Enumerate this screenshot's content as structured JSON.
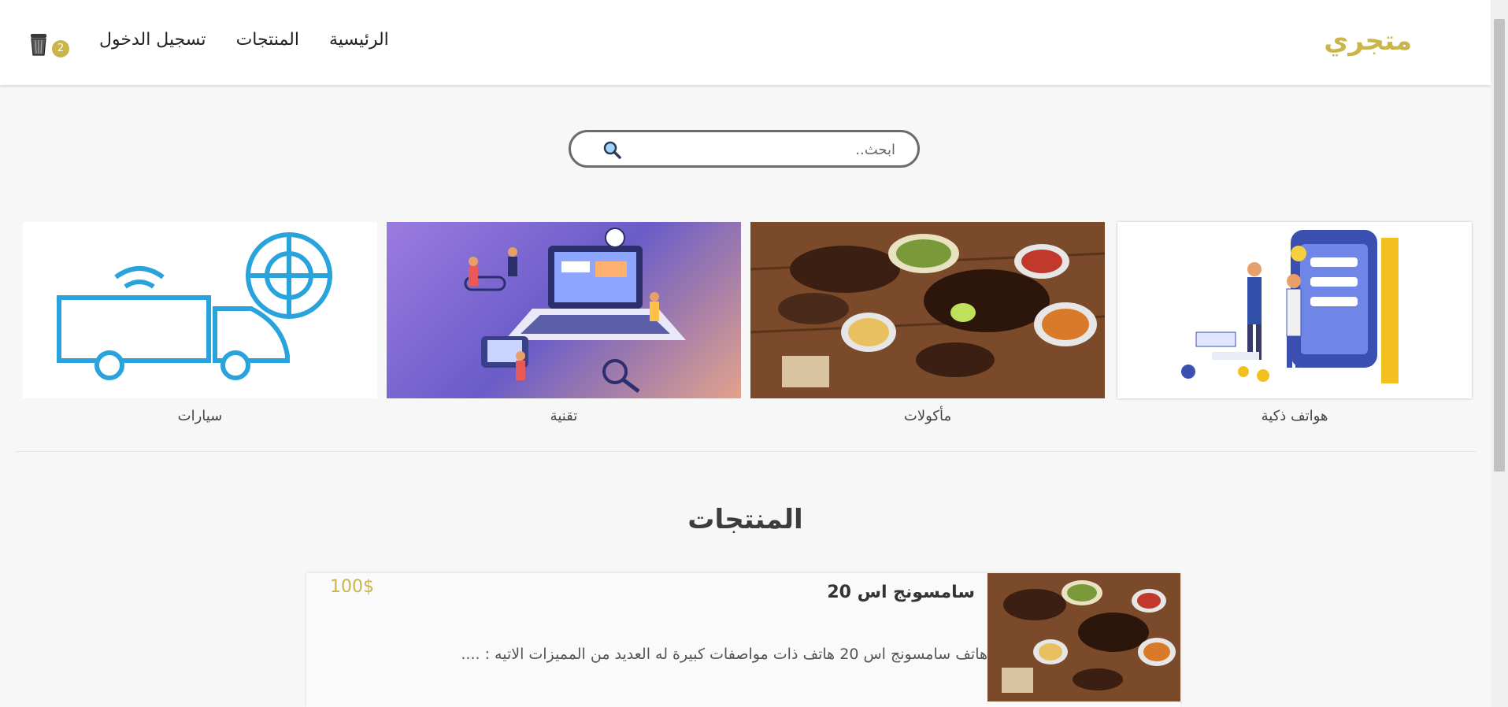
{
  "header": {
    "brand": "متجري",
    "nav": [
      "الرئيسية",
      "المنتجات",
      "تسجيل الدخول"
    ],
    "cart_count": "2",
    "cart_icon": "trash-bin-icon"
  },
  "search": {
    "placeholder": "ابحث..",
    "icon": "search-icon"
  },
  "categories": [
    {
      "label": "هواتف ذكية"
    },
    {
      "label": "مأكولات"
    },
    {
      "label": "تقنية"
    },
    {
      "label": "سيارات"
    }
  ],
  "products_section": {
    "title": "المنتجات"
  },
  "products": [
    {
      "name": "سامسونج اس 20",
      "price": "100$",
      "description": "هاتف سامسونج اس 20 هاتف ذات مواصفات كبيرة له العديد من المميزات الاتيه : ...."
    }
  ],
  "colors": {
    "accent": "#c9b54a",
    "truck": "#29a3dc"
  }
}
